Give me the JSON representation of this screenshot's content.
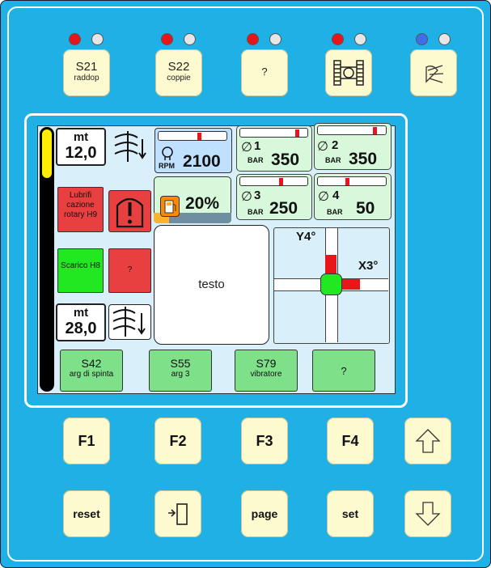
{
  "top_keys": [
    {
      "label": "S21",
      "sub": "raddop",
      "leds": [
        "red",
        "off"
      ]
    },
    {
      "label": "S22",
      "sub": "coppie",
      "leds": [
        "red",
        "off"
      ]
    },
    {
      "label": "?",
      "sub": "",
      "leds": [
        "red",
        "off"
      ]
    },
    {
      "label": "",
      "sub": "",
      "icon": "tracked-vehicle-icon",
      "leds": [
        "red",
        "off"
      ]
    },
    {
      "label": "",
      "sub": "",
      "icon": "work-light-icon",
      "leds": [
        "blue",
        "off"
      ]
    }
  ],
  "screen": {
    "depth_top": {
      "unit": "mt",
      "value": "12,0"
    },
    "depth_bottom": {
      "unit": "mt",
      "value": "28,0"
    },
    "rpm": {
      "label": "RPM",
      "value": "2100",
      "level": 0.62
    },
    "fuel": {
      "value": "20%",
      "level": 0.2
    },
    "pressures": [
      {
        "index": "1",
        "unit": "BAR",
        "value": "350",
        "level": 0.87
      },
      {
        "index": "2",
        "unit": "BAR",
        "value": "350",
        "level": 0.87
      },
      {
        "index": "3",
        "unit": "BAR",
        "value": "250",
        "level": 0.62
      },
      {
        "index": "4",
        "unit": "BAR",
        "value": "50",
        "level": 0.44
      }
    ],
    "alarm_lubrifi": {
      "text": "Lubrifi cazione rotary H9"
    },
    "scarico": {
      "text": "Scarico H8"
    },
    "unknown_red": {
      "text": "?"
    },
    "message": {
      "text": "testo"
    },
    "tilt": {
      "y_label": "Y4°",
      "x_label": "X3°",
      "y_deg": 4,
      "x_deg": 3
    },
    "soft_buttons": [
      {
        "label": "S42",
        "sub": "arg di spinta"
      },
      {
        "label": "S55",
        "sub": "arg 3"
      },
      {
        "label": "S79",
        "sub": "vibratore"
      },
      {
        "label": "?",
        "sub": ""
      }
    ]
  },
  "fkeys": [
    "F1",
    "F2",
    "F3",
    "F4"
  ],
  "bottom_keys": {
    "reset": "reset",
    "page": "page",
    "set": "set"
  },
  "colors": {
    "panel": "#1fb1e6",
    "key": "#fdfad0",
    "led_red": "#e8161b",
    "led_blue": "#3f6fe8",
    "alarm": "#e84040",
    "ok_green": "#22e822",
    "screen": "#d9f0fb"
  }
}
